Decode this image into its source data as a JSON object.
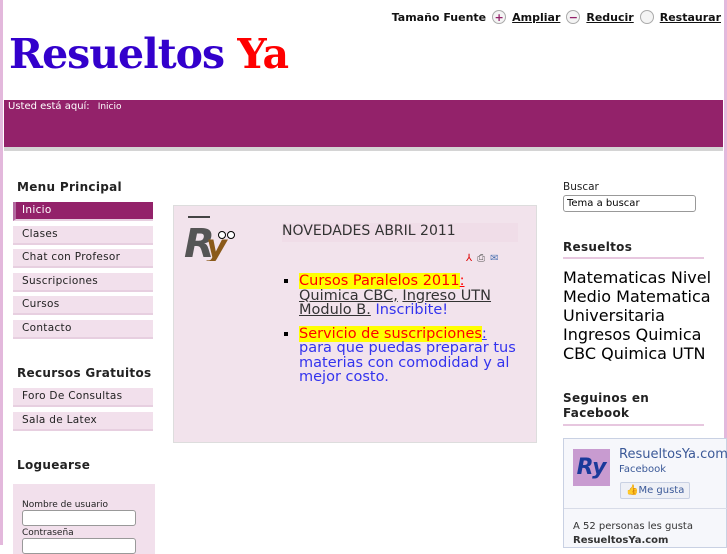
{
  "font_size": {
    "label": "Tamaño Fuente",
    "enlarge": "Ampliar",
    "reduce": "Reducir",
    "reset": "Restaurar"
  },
  "logo": {
    "part1": "Resueltos",
    "part2": "Ya"
  },
  "breadcrumb": {
    "label": "Usted está aquí:",
    "current": "Inicio"
  },
  "main_menu": {
    "title": "Menu Principal",
    "items": [
      "Inicio",
      "Clases",
      "Chat con Profesor",
      "Suscripciones",
      "Cursos",
      "Contacto"
    ]
  },
  "free_resources": {
    "title": "Recursos Gratuitos",
    "items": [
      "Foro De Consultas",
      "Sala de Latex"
    ]
  },
  "login": {
    "title": "Loguearse",
    "username_label": "Nombre de usuario",
    "password_label": "Contraseña"
  },
  "article": {
    "title": "NOVEDADES ABRIL 2011",
    "item1": {
      "highlight": "Cursos Paralelos 2011",
      "colon": ":",
      "link1": "Quimica CBC,",
      "link2": "Ingreso UTN Modulo B.",
      "cta": "Inscribite!"
    },
    "item2": {
      "highlight": "Servicio de suscripciones",
      "colon": ":",
      "text": "para que puedas preparar tus materias con comodidad y al mejor costo."
    }
  },
  "search": {
    "label": "Buscar",
    "value": "Tema a buscar"
  },
  "resueltos": {
    "title": "Resueltos",
    "items": [
      "Matematicas Nivel Medio",
      "Matematica Universitaria",
      "Ingresos",
      "Quimica CBC",
      "Quimica UTN"
    ]
  },
  "facebook": {
    "title": "Seguinos en Facebook",
    "page_name": "ResueltosYa.com",
    "sub": "Facebook",
    "like": "Me gusta",
    "count_text": "A 52 personas les gusta",
    "page_bold": "ResueltosYa.com",
    "logo_text": "Ry"
  },
  "colors": {
    "brand": "#93226a",
    "logo_blue": "#3300cc",
    "logo_red": "#ff0000"
  }
}
